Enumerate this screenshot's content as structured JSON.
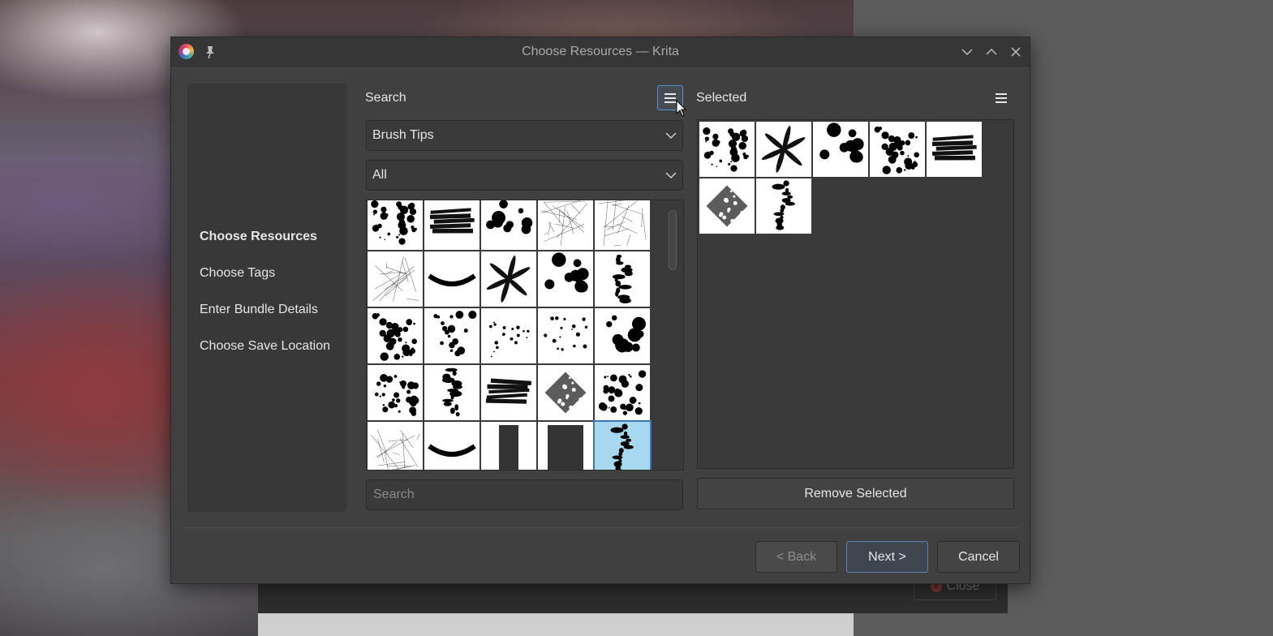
{
  "window": {
    "title": "Choose Resources — Krita"
  },
  "background": {
    "close_label": "Close"
  },
  "sidebar": {
    "items": [
      {
        "label": "Choose Resources",
        "active": true
      },
      {
        "label": "Choose Tags",
        "active": false
      },
      {
        "label": "Enter Bundle Details",
        "active": false
      },
      {
        "label": "Choose Save Location",
        "active": false
      }
    ]
  },
  "search_panel": {
    "title": "Search",
    "resource_type": "Brush Tips",
    "tag": "All",
    "search_placeholder": "Search",
    "tiles": [
      {
        "icon": "noise-blob-brush-icon"
      },
      {
        "icon": "rough-stroke-brush-icon"
      },
      {
        "icon": "dots-cluster-brush-icon"
      },
      {
        "icon": "soft-smear-brush-icon"
      },
      {
        "icon": "faint-streak-brush-icon"
      },
      {
        "icon": "crackle-brush-icon"
      },
      {
        "icon": "charcoal-blob-brush-icon"
      },
      {
        "icon": "leaf-brush-icon"
      },
      {
        "icon": "big-dots-brush-icon"
      },
      {
        "icon": "dotted-line-brush-icon"
      },
      {
        "icon": "splatter-brush-icon"
      },
      {
        "icon": "sparse-splatter-brush-icon"
      },
      {
        "icon": "fine-splatter-brush-icon"
      },
      {
        "icon": "scattered-dots-brush-icon"
      },
      {
        "icon": "bubble-dots-brush-icon"
      },
      {
        "icon": "blotch-brush-icon"
      },
      {
        "icon": "vertical-texture-brush-icon"
      },
      {
        "icon": "rough-stroke-2-brush-icon"
      },
      {
        "icon": "diamond-texture-brush-icon"
      },
      {
        "icon": "camo-blob-brush-icon"
      },
      {
        "icon": "hatch-texture-brush-icon"
      },
      {
        "icon": "arc-stroke-brush-icon"
      },
      {
        "icon": "vertical-bar-brush-icon"
      },
      {
        "icon": "dark-square-brush-icon"
      },
      {
        "icon": "spine-brush-icon",
        "selected": true
      }
    ]
  },
  "selected_panel": {
    "title": "Selected",
    "remove_label": "Remove Selected",
    "tiles": [
      {
        "icon": "noise-blob-brush-icon"
      },
      {
        "icon": "leaf-brush-icon"
      },
      {
        "icon": "big-dots-brush-icon"
      },
      {
        "icon": "splatter-brush-icon"
      },
      {
        "icon": "rough-stroke-brush-icon"
      },
      {
        "icon": "diamond-texture-brush-icon"
      },
      {
        "icon": "spine-brush-icon"
      }
    ]
  },
  "buttons": {
    "back": "< Back",
    "next": "Next >",
    "cancel": "Cancel"
  }
}
